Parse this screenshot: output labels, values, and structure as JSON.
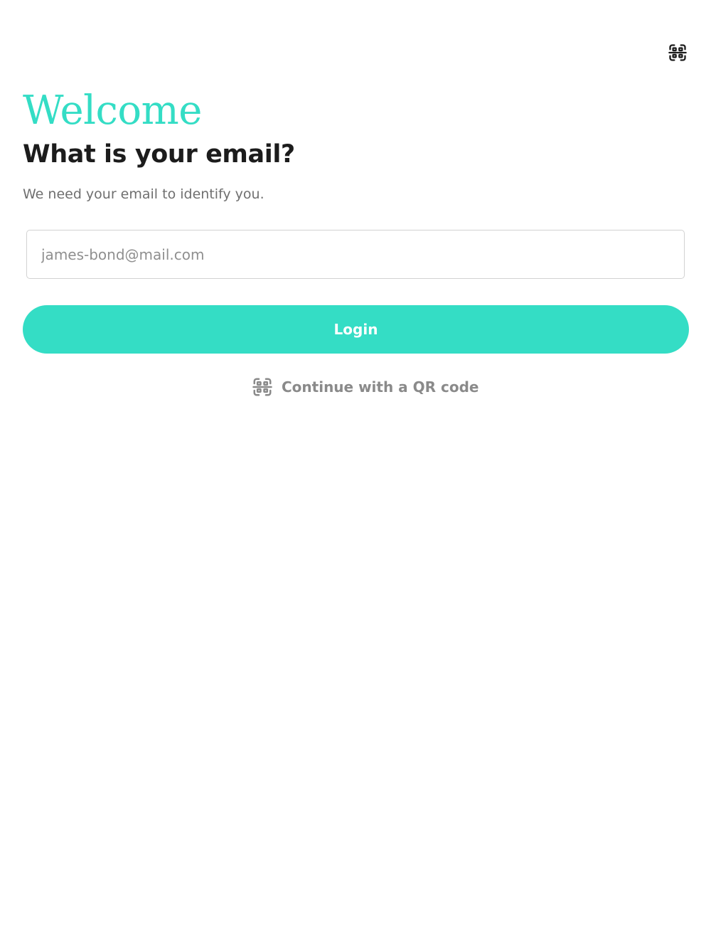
{
  "header": {
    "qr_icon": "qr-scan-icon"
  },
  "welcome": {
    "title": "Welcome",
    "heading": "What is your email?",
    "subtitle": "We need your email to identify you."
  },
  "form": {
    "email_value": "",
    "email_placeholder": "james-bond@mail.com",
    "login_label": "Login",
    "qr_link_label": "Continue with a QR code",
    "qr_link_icon": "qr-scan-icon"
  },
  "colors": {
    "accent": "#34ddc5",
    "heading": "#1c1c1c",
    "muted": "#6f6f6f",
    "link": "#8a8a8a",
    "border": "#d2d2d2"
  }
}
